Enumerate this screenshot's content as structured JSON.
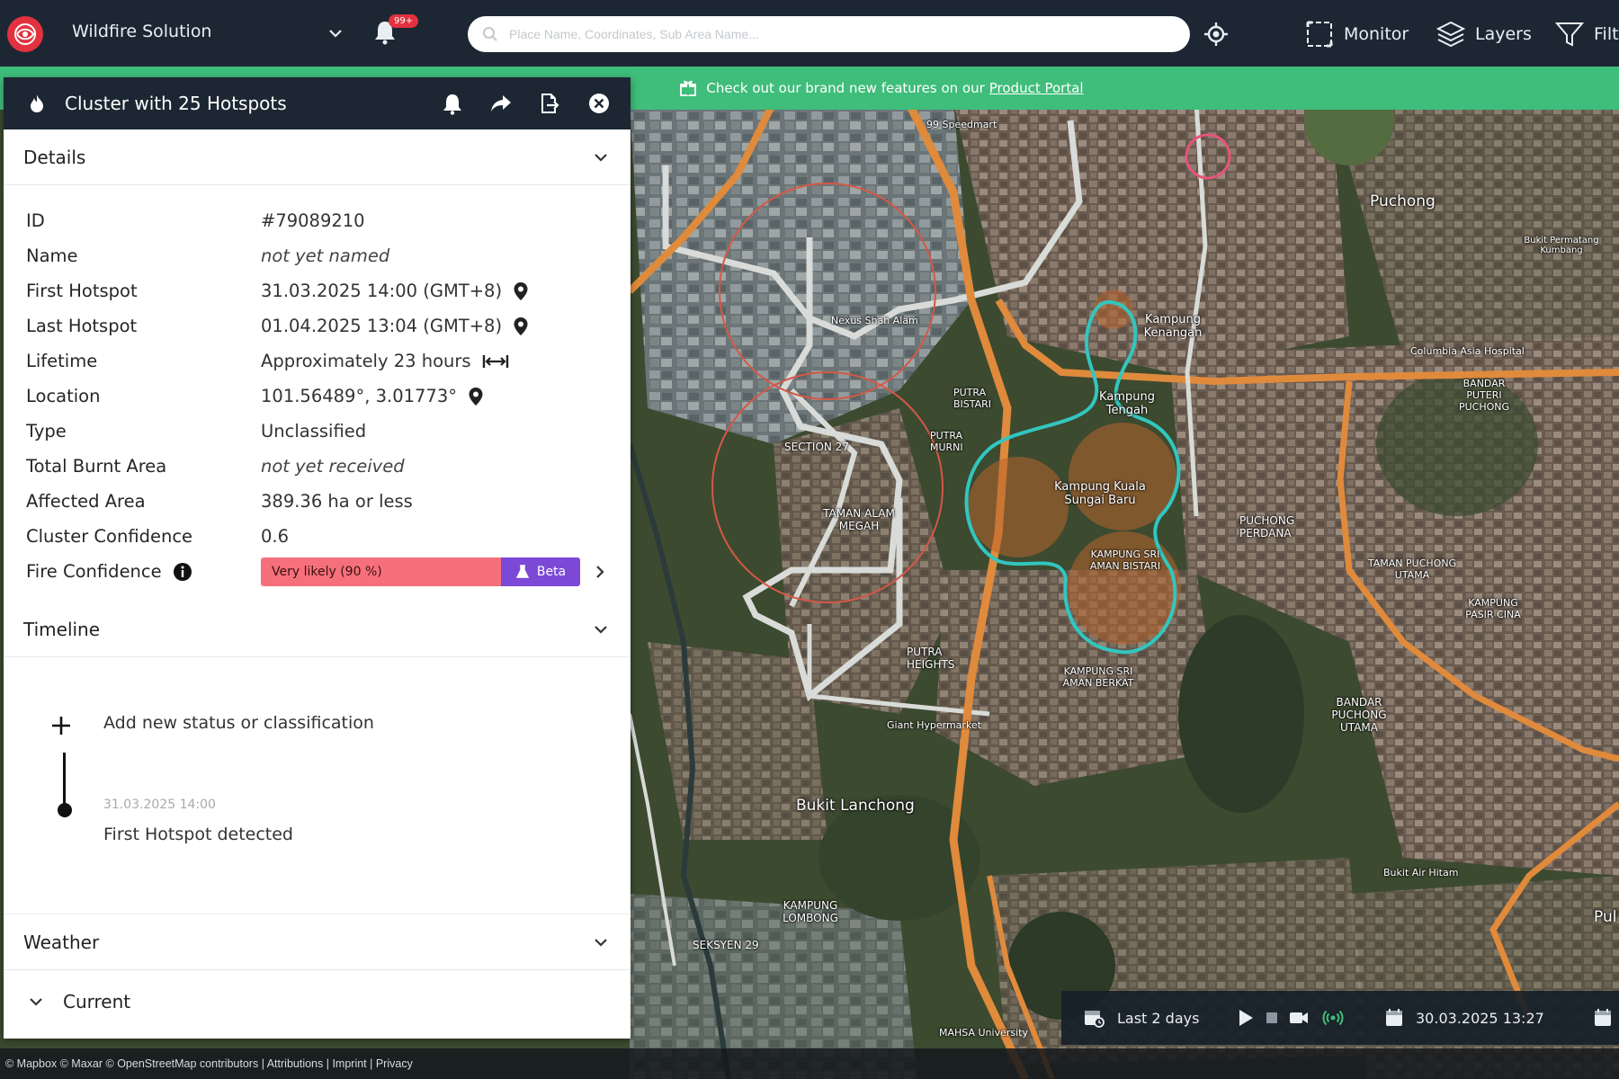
{
  "topbar": {
    "app_title": "Wildfire Solution",
    "notification_badge": "99+",
    "search_placeholder": "Place Name, Coordinates, Sub Area Name...",
    "monitor_label": "Monitor",
    "layers_label": "Layers",
    "filter_label": "Filt",
    "colors": {
      "bar": "#1c2733",
      "accent": "#e2323f"
    }
  },
  "banner": {
    "text": "Check out our brand new features on our",
    "link": "Product Portal",
    "color": "#3fbd7a"
  },
  "panel": {
    "title": "Cluster with 25 Hotspots",
    "header_icons": [
      "bell-icon",
      "share-icon",
      "export-icon",
      "close-icon"
    ],
    "details_title": "Details",
    "details": {
      "id_label": "ID",
      "id_value": "#79089210",
      "name_label": "Name",
      "name_value": "not yet named",
      "first_label": "First Hotspot",
      "first_value": "31.03.2025 14:00 (GMT+8)",
      "last_label": "Last Hotspot",
      "last_value": "01.04.2025 13:04 (GMT+8)",
      "lifetime_label": "Lifetime",
      "lifetime_value": "Approximately 23 hours",
      "location_label": "Location",
      "location_value": "101.56489°, 3.01773°",
      "type_label": "Type",
      "type_value": "Unclassified",
      "burnt_label": "Total Burnt Area",
      "burnt_value": "not yet received",
      "affected_label": "Affected Area",
      "affected_value": "389.36 ha or less",
      "cluster_conf_label": "Cluster Confidence",
      "cluster_conf_value": "0.6",
      "fire_conf_label": "Fire Confidence",
      "fire_conf_value": "Very likely (90 %)",
      "fire_conf_badge": "Beta"
    },
    "timeline_title": "Timeline",
    "timeline": {
      "add_label": "Add new status or classification",
      "event_date": "31.03.2025 14:00",
      "event_text": "First Hotspot detected"
    },
    "weather_title": "Weather",
    "current_label": "Current"
  },
  "map": {
    "labels": {
      "puchong": "Puchong",
      "bukit_lanchong": "Bukit Lanchong",
      "kuala": "Kampung Kuala Sungai Baru",
      "sri_aman_bistari": "KAMPUNG SRI AMAN BISTARI",
      "kampung_tengah": "Kampung Tengah",
      "kampung_kenangan": "Kampung Kenangan",
      "taman_alam_megah": "TAMAN ALAM MEGAH",
      "section_27": "SECTION 27",
      "putra_heights": "PUTRA HEIGHTS",
      "puchong_perdana": "PUCHONG PERDANA",
      "bandar_puchong_utama": "BANDAR PUCHONG UTAMA",
      "seksyen_29": "SEKSYEN 29",
      "kampung_lombong": "KAMPUNG LOMBONG",
      "nexus": "Nexus Shah Alam",
      "giant": "Giant Hypermarket",
      "bukit_air_hitam": "Bukit Air Hitam",
      "sri_aman_berkat": "KAMPUNG SRI AMAN BERKAT",
      "taman_puchong_utama": "TAMAN PUCHONG UTAMA",
      "speedmart": "99 Speedmart",
      "columbia": "Columbia Asia Hospital",
      "bandar_puteri": "BANDAR PUTERI PUCHONG",
      "mahsa": "MAHSA University",
      "putra_bistari": "PUTRA BISTARI",
      "putra_murni": "PUTRA MURNI",
      "kampung_pasir_cina": "KAMPUNG PASIR CINA",
      "bukit_permatang": "Bukit Permatang Kumbang",
      "pul": "Pul"
    }
  },
  "timebar": {
    "range_label": "Last 2 days",
    "date_value": "30.03.2025 13:27"
  },
  "attribution": "© Mapbox © Maxar © OpenStreetMap contributors | Attributions | Imprint | Privacy"
}
